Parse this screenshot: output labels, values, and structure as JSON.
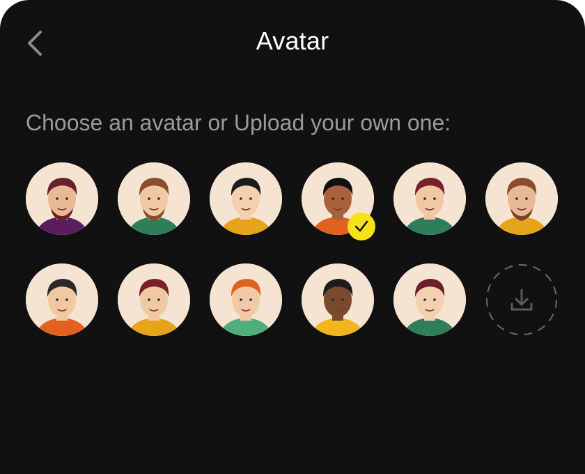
{
  "header": {
    "title": "Avatar",
    "back_icon": "chevron-left-icon"
  },
  "prompt": "Choose an avatar or Upload your own one:",
  "colors": {
    "background": "#111111",
    "title": "#ffffff",
    "prompt": "#9b9b9b",
    "avatar_bg": "#f6e4d3",
    "selected_badge": "#f6e216"
  },
  "avatars": [
    {
      "id": "avatar-1",
      "hair": "#6a1f2a",
      "beard": "#6a1f2a",
      "shirt": "#5a1e5e",
      "skin": "#e9b894",
      "selected": false
    },
    {
      "id": "avatar-2",
      "hair": "#8a4e2e",
      "beard": "#8a4e2e",
      "shirt": "#2e7d5b",
      "skin": "#f0c8a4",
      "selected": false
    },
    {
      "id": "avatar-3",
      "hair": "#1c1c1c",
      "beard": null,
      "shirt": "#e5a419",
      "skin": "#f2d0b0",
      "selected": false
    },
    {
      "id": "avatar-4",
      "hair": "#111111",
      "beard": null,
      "shirt": "#e2611f",
      "skin": "#a8623b",
      "selected": true
    },
    {
      "id": "avatar-5",
      "hair": "#7b1f2a",
      "beard": null,
      "shirt": "#2e7d5b",
      "skin": "#f0c8a4",
      "selected": false
    },
    {
      "id": "avatar-6",
      "hair": "#8a4e2e",
      "beard": "#7a4328",
      "shirt": "#e5a419",
      "skin": "#e9b894",
      "selected": false
    },
    {
      "id": "avatar-7",
      "hair": "#2a2a2a",
      "beard": null,
      "shirt": "#e2611f",
      "skin": "#f0c8a4",
      "selected": false
    },
    {
      "id": "avatar-8",
      "hair": "#7b1f2a",
      "beard": null,
      "shirt": "#e5a419",
      "skin": "#f0c8a4",
      "selected": false
    },
    {
      "id": "avatar-9",
      "hair": "#e2611f",
      "beard": null,
      "shirt": "#4fae7a",
      "skin": "#f2c9a6",
      "selected": false
    },
    {
      "id": "avatar-10",
      "hair": "#1c1c1c",
      "beard": null,
      "shirt": "#f2b51e",
      "skin": "#7a4a2e",
      "selected": false
    },
    {
      "id": "avatar-11",
      "hair": "#6a1f2a",
      "beard": null,
      "shirt": "#2e7d5b",
      "skin": "#f2d0b0",
      "selected": false
    }
  ],
  "upload": {
    "icon": "download-tray-icon"
  }
}
